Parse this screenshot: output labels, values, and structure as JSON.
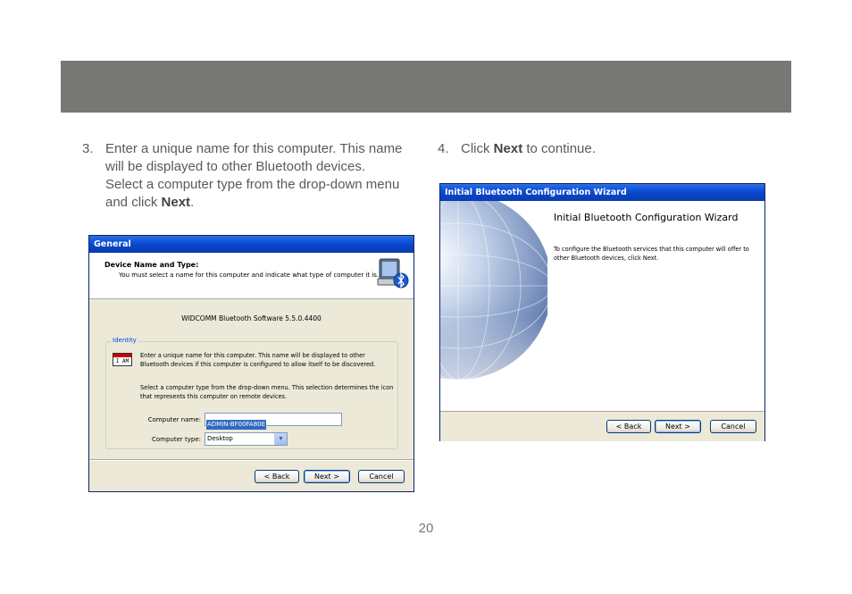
{
  "header": {},
  "steps": [
    {
      "number": "3.",
      "text_before": "Enter a unique name for this computer.  This name will be displayed to other Bluetooth devices.  Select a computer type from the drop-down menu and click ",
      "bold": "Next",
      "text_after": "."
    },
    {
      "number": "4.",
      "text_before": "Click ",
      "bold": "Next",
      "text_after": " to continue."
    }
  ],
  "general_window": {
    "title": "General",
    "banner_title": "Device Name and Type:",
    "banner_subtitle": "You must select a name for this computer and indicate what type of computer it is.",
    "version": "WIDCOMM Bluetooth Software 5.5.0.4400",
    "group_label": "Identity",
    "icon_text": "I AM",
    "paragraph1": "Enter a unique name for this computer.  This name will be displayed to other Bluetooth devices if this computer is configured to allow itself to be discovered.",
    "paragraph2": "Select a computer type from the drop-down menu.  This selection determines the icon that represents this computer on remote devices.",
    "name_label": "Computer name:",
    "name_value": "ADMIN-BF00FA80E",
    "type_label": "Computer type:",
    "type_value": "Desktop",
    "buttons": {
      "back": "< Back",
      "next": "Next >",
      "cancel": "Cancel"
    }
  },
  "wizard_window": {
    "title": "Initial Bluetooth Configuration Wizard",
    "heading": "Initial Bluetooth Configuration Wizard",
    "body": "To configure the Bluetooth services that this computer will offer to other Bluetooth devices, click Next.",
    "buttons": {
      "back": "< Back",
      "next": "Next >",
      "cancel": "Cancel"
    }
  },
  "page_number": "20",
  "colors": {
    "header_bar": "#777874",
    "xp_title": "#0a4fd8"
  }
}
